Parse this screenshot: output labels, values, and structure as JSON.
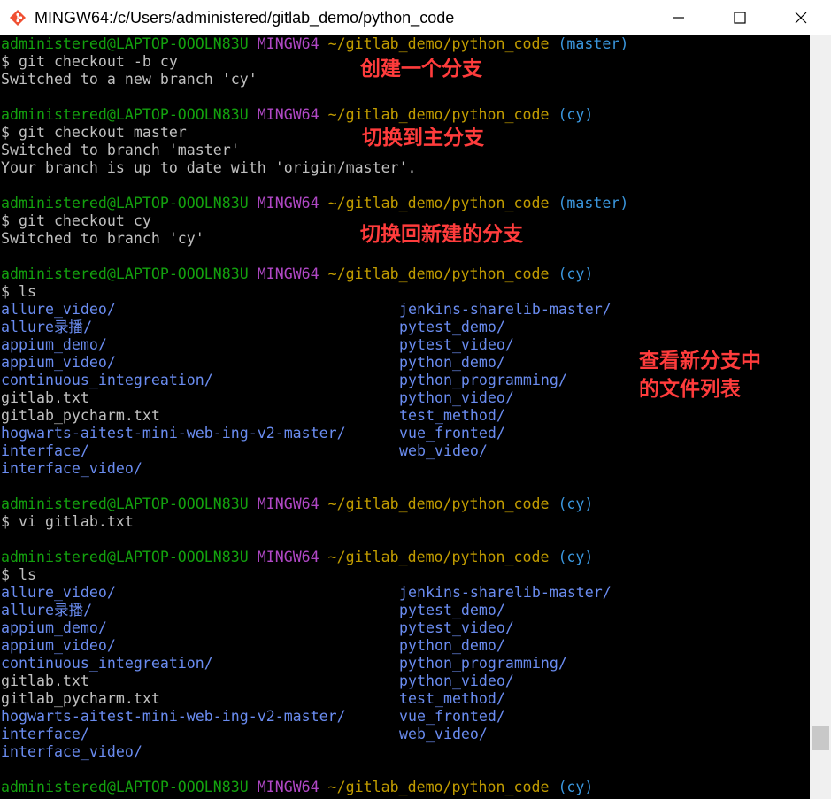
{
  "window": {
    "title": "MINGW64:/c/Users/administered/gitlab_demo/python_code"
  },
  "prompt": {
    "user": "administered@LAPTOP-OOOLN83U",
    "env": "MINGW64",
    "path": "~/gitlab_demo/python_code"
  },
  "blocks": {
    "b1": {
      "branch": "(master)",
      "command": "$ git checkout -b cy",
      "output1": "Switched to a new branch 'cy'"
    },
    "b2": {
      "branch": "(cy)",
      "command": "$ git checkout master",
      "output1": "Switched to branch 'master'",
      "output2": "Your branch is up to date with 'origin/master'."
    },
    "b3": {
      "branch": "(master)",
      "command": "$ git checkout cy",
      "output1": "Switched to branch 'cy'"
    },
    "b4": {
      "branch": "(cy)",
      "command": "$ ls"
    },
    "b5": {
      "branch": "(cy)",
      "command": "$ vi gitlab.txt"
    },
    "b6": {
      "branch": "(cy)",
      "command": "$ ls"
    },
    "b7": {
      "branch": "(cy)"
    }
  },
  "listing": {
    "left": [
      "allure_video/",
      "allure录播/",
      "appium_demo/",
      "appium_video/",
      "continuous_integreation/",
      "gitlab.txt",
      "gitlab_pycharm.txt",
      "hogwarts-aitest-mini-web-ing-v2-master/",
      "interface/",
      "interface_video/"
    ],
    "left_is_dir": [
      true,
      true,
      true,
      true,
      true,
      false,
      false,
      true,
      true,
      true
    ],
    "right": [
      "jenkins-sharelib-master/",
      "pytest_demo/",
      "pytest_video/",
      "python_demo/",
      "python_programming/",
      "python_video/",
      "test_method/",
      "vue_fronted/",
      "web_video/"
    ]
  },
  "annotations": {
    "a1": "创建一个分支",
    "a2": "切换到主分支",
    "a3": "切换回新建的分支",
    "a4_line1": "查看新分支中",
    "a4_line2": "的文件列表"
  },
  "colors": {
    "user": "#13a10e",
    "env": "#b148c6",
    "path": "#c19c00",
    "branch": "#3a96dd",
    "dir": "#6a8cf0",
    "annotation": "#ff3c3c"
  },
  "icons": {
    "app": "git-bash-icon",
    "min": "minimize-icon",
    "max": "maximize-icon",
    "close": "close-icon"
  }
}
